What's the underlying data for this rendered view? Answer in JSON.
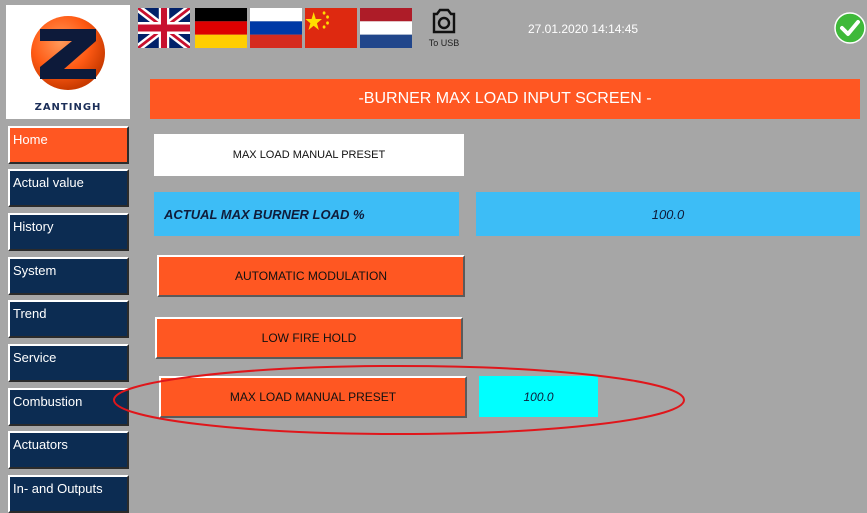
{
  "brand": {
    "name": "ZANTINGH"
  },
  "languages": [
    {
      "name": "english-flag"
    },
    {
      "name": "german-flag"
    },
    {
      "name": "russian-flag"
    },
    {
      "name": "chinese-flag"
    },
    {
      "name": "dutch-flag"
    }
  ],
  "header": {
    "usb_label": "To USB",
    "datetime": "27.01.2020  14:14:45",
    "status_icon": "checkmark-icon"
  },
  "title": "-BURNER MAX LOAD INPUT SCREEN -",
  "sidebar": {
    "items": [
      {
        "label": "Home",
        "active": true
      },
      {
        "label": "Actual value"
      },
      {
        "label": "History"
      },
      {
        "label": "System"
      },
      {
        "label": "Trend"
      },
      {
        "label": "Service"
      },
      {
        "label": "Combustion"
      },
      {
        "label": "Actuators"
      },
      {
        "label": "In- and Outputs"
      }
    ]
  },
  "main": {
    "mode_indicator": "MAX LOAD MANUAL PRESET",
    "actual_label": "ACTUAL MAX BURNER LOAD %",
    "actual_value": "100.0",
    "buttons": {
      "automatic": "AUTOMATIC MODULATION",
      "low_fire": "LOW FIRE HOLD",
      "manual_preset": "MAX LOAD MANUAL PRESET"
    },
    "preset_value": "100.0"
  },
  "colors": {
    "accent": "#ff5722",
    "nav_bg": "#0c2c52",
    "info_blue": "#3dbdf6",
    "input_cyan": "#00ffff",
    "background": "#a6a6a6",
    "annotation_red": "#e0161b"
  }
}
